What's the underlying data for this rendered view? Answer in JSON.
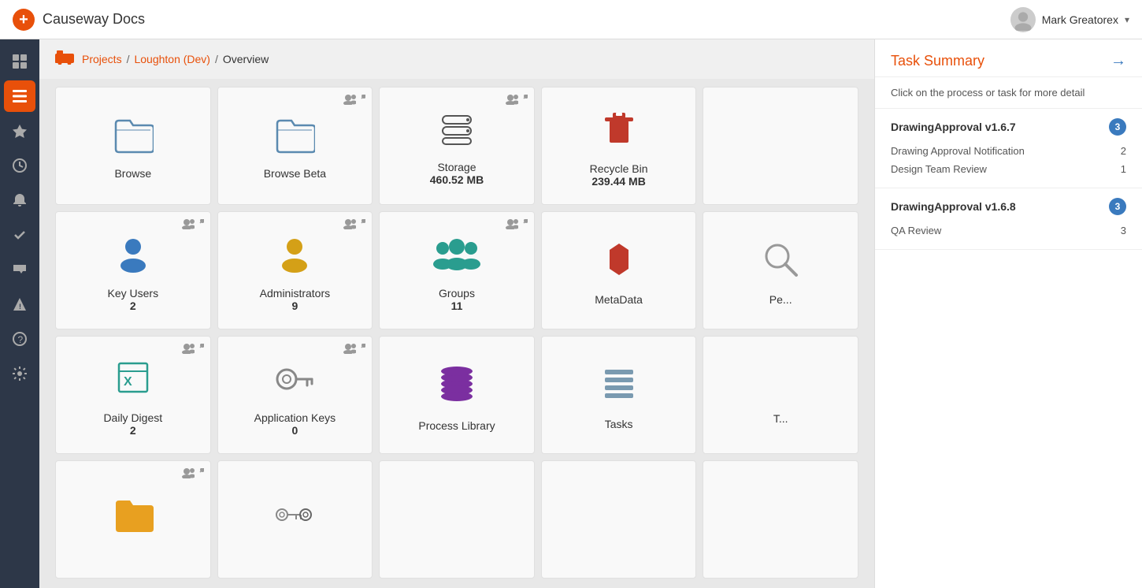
{
  "app": {
    "title": "Causeway Docs",
    "user": "Mark Greatorex"
  },
  "breadcrumb": {
    "icon": "🚛",
    "projects_label": "Projects",
    "separator1": "/",
    "project_label": "Loughton (Dev)",
    "separator2": "/",
    "current_label": "Overview"
  },
  "sidebar": {
    "items": [
      {
        "id": "grid",
        "icon": "⊞",
        "active": false
      },
      {
        "id": "list",
        "icon": "☰",
        "active": true
      },
      {
        "id": "star",
        "icon": "★",
        "active": false
      },
      {
        "id": "clock",
        "icon": "◷",
        "active": false
      },
      {
        "id": "bell",
        "icon": "🔔",
        "active": false
      },
      {
        "id": "check",
        "icon": "✓",
        "active": false
      },
      {
        "id": "inbox",
        "icon": "📥",
        "active": false
      },
      {
        "id": "warning",
        "icon": "⚠",
        "active": false
      },
      {
        "id": "question",
        "icon": "?",
        "active": false
      },
      {
        "id": "settings",
        "icon": "⚙",
        "active": false
      }
    ]
  },
  "tiles": [
    {
      "id": "browse",
      "label": "Browse",
      "value": null,
      "icon_type": "browse",
      "admin": false
    },
    {
      "id": "browse-beta",
      "label": "Browse Beta",
      "value": null,
      "icon_type": "browse",
      "admin": true
    },
    {
      "id": "storage",
      "label": "Storage",
      "value": "460.52 MB",
      "icon_type": "storage",
      "admin": true
    },
    {
      "id": "recycle-bin",
      "label": "Recycle Bin",
      "value": "239.44 MB",
      "icon_type": "recycle",
      "admin": false
    },
    {
      "id": "placeholder1",
      "label": "",
      "value": null,
      "icon_type": "none",
      "admin": false
    },
    {
      "id": "key-users",
      "label": "Key Users",
      "value": "2",
      "icon_type": "keyusers",
      "admin": true
    },
    {
      "id": "administrators",
      "label": "Administrators",
      "value": "9",
      "icon_type": "admins",
      "admin": true
    },
    {
      "id": "groups",
      "label": "Groups",
      "value": "11",
      "icon_type": "groups",
      "admin": true
    },
    {
      "id": "metadata",
      "label": "MetaData",
      "value": null,
      "icon_type": "metadata",
      "admin": false
    },
    {
      "id": "permissions",
      "label": "Pe...",
      "value": null,
      "icon_type": "permissions",
      "admin": false
    },
    {
      "id": "daily-digest",
      "label": "Daily Digest",
      "value": "2",
      "icon_type": "dailydigest",
      "admin": true
    },
    {
      "id": "application-keys",
      "label": "Application Keys",
      "value": "0",
      "icon_type": "appkeys",
      "admin": true
    },
    {
      "id": "process-library",
      "label": "Process Library",
      "value": null,
      "icon_type": "processlibrary",
      "admin": false
    },
    {
      "id": "tasks",
      "label": "Tasks",
      "value": null,
      "icon_type": "tasks",
      "admin": false
    },
    {
      "id": "placeholder2",
      "label": "T...",
      "value": null,
      "icon_type": "none",
      "admin": false
    },
    {
      "id": "row4a",
      "label": "",
      "value": null,
      "icon_type": "folder-orange",
      "admin": true
    },
    {
      "id": "row4b",
      "label": "",
      "value": null,
      "icon_type": "key-pair",
      "admin": false
    },
    {
      "id": "row4c",
      "label": "",
      "value": null,
      "icon_type": "pin-pair",
      "admin": false
    },
    {
      "id": "row4d",
      "label": "",
      "value": null,
      "icon_type": "pin-pair-red",
      "admin": false
    },
    {
      "id": "row4e",
      "label": "",
      "value": null,
      "icon_type": "none",
      "admin": false
    }
  ],
  "task_panel": {
    "title": "Task Summary",
    "info_text": "Click on the process or task for more detail",
    "sections": [
      {
        "id": "drawing-approval-167",
        "title": "DrawingApproval v1.6.7",
        "badge": "3",
        "items": [
          {
            "label": "Drawing Approval Notification",
            "count": "2"
          },
          {
            "label": "Design Team Review",
            "count": "1"
          }
        ]
      },
      {
        "id": "drawing-approval-168",
        "title": "DrawingApproval v1.6.8",
        "badge": "3",
        "items": [
          {
            "label": "QA Review",
            "count": "3"
          }
        ]
      }
    ]
  }
}
